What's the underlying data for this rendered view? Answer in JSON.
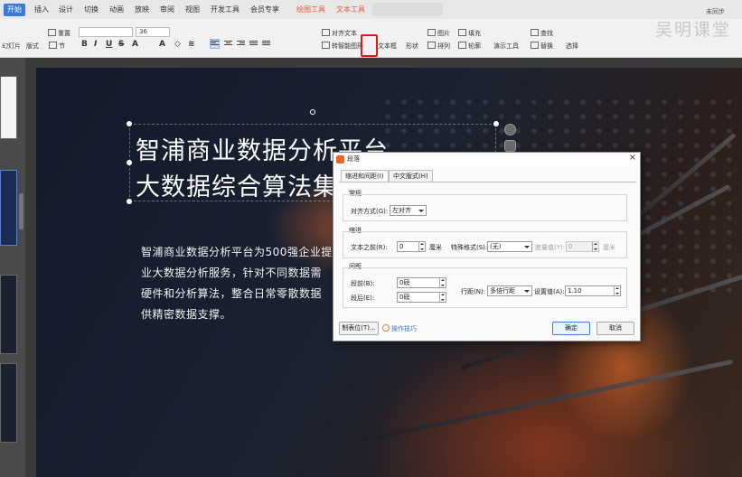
{
  "brand": "吴明课堂",
  "ribbon": {
    "tabs": [
      {
        "label": "开始",
        "active": true
      },
      {
        "label": "插入"
      },
      {
        "label": "设计"
      },
      {
        "label": "切换"
      },
      {
        "label": "动画"
      },
      {
        "label": "放映"
      },
      {
        "label": "审阅"
      },
      {
        "label": "视图"
      },
      {
        "label": "开发工具"
      },
      {
        "label": "会员专享"
      },
      {
        "label": "绘图工具"
      },
      {
        "label": "文本工具"
      }
    ],
    "reset": "重置",
    "font_size": "36",
    "align_text": "对齐文本",
    "smart_graphic": "转智能图形",
    "text_box": "文本框",
    "shape": "形状",
    "picture": "图片",
    "arrange": "排列",
    "fill": "填充",
    "outline": "轮廓",
    "presentation_tools": "演示工具",
    "find": "查找",
    "replace": "替换",
    "select": "选择",
    "new_slide": "幻灯片",
    "layout": "版式",
    "section": "节",
    "user": "未同步"
  },
  "slide": {
    "title_line1": "智浦商业数据分析平台",
    "title_line2": "大数据综合算法集",
    "body_line1": "智浦商业数据分析平台为500强企业提",
    "body_line2": "业大数据分析服务，针对不同数据需",
    "body_line3": "硬件和分析算法，整合日常零散数据",
    "body_line4": "供精密数据支撑。"
  },
  "dialog": {
    "title": "段落",
    "tabs": [
      "缩进和间距(I)",
      "中文版式(H)"
    ],
    "general": {
      "label": "常规",
      "alignment_label": "对齐方式(G):",
      "alignment_value": "左对齐"
    },
    "indent": {
      "label": "缩进",
      "before_text_label": "文本之前(R):",
      "before_text_value": "0",
      "before_text_unit": "厘米",
      "special_label": "特殊格式(S):",
      "special_value": "(无)",
      "measure_label": "度量值(Y):",
      "measure_value": "0",
      "measure_unit": "厘米"
    },
    "spacing": {
      "label": "间距",
      "before_label": "段前(B):",
      "before_value": "0磅",
      "after_label": "段后(E):",
      "after_value": "0磅",
      "line_spacing_label": "行距(N):",
      "line_spacing_value": "多倍行距",
      "setting_label": "设置值(A):",
      "setting_value": "1.10"
    },
    "tabs_button": "制表位(T)...",
    "tips_link": "操作技巧",
    "ok": "确定",
    "cancel": "取消"
  }
}
